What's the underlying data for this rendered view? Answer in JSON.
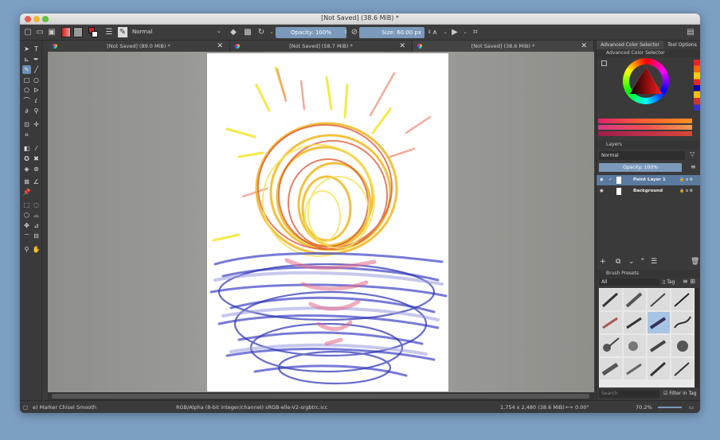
{
  "window": {
    "title": "[Not Saved]  (38.6 MiB) *"
  },
  "toolbar": {
    "blend_mode": "Normal",
    "opacity_label": "Opacity: 100%",
    "size_label": "Size: 60.00 px"
  },
  "tabs": [
    {
      "label": "[Not Saved]  (89.0 MiB) *",
      "close": "✕"
    },
    {
      "label": "[Not Saved]  (58.7 MiB) *",
      "close": "✕"
    },
    {
      "label": "[Not Saved]  (38.6 MiB) *",
      "close": "✕"
    }
  ],
  "dock": {
    "tab_color_selector": "Advanced Color Selector",
    "tab_tool_options": "Tool Options",
    "color_selector_title": "Advanced Color Selector",
    "layers_title": "Layers",
    "layers_blend": "Normal",
    "layers_opacity": "Opacity:  100%",
    "layers": [
      {
        "name": "Paint Layer 1",
        "selected": true
      },
      {
        "name": "Background",
        "selected": false
      }
    ],
    "brush_presets_title": "Brush Presets",
    "brush_filter": "All",
    "brush_tag": "Tag",
    "search_placeholder": "Search",
    "filter_in_tag": "Filter in Tag"
  },
  "status": {
    "brush": "e) Marker Chisel Smooth",
    "color_space": "RGB/Alpha (8-bit integer/channel)  sRGB-elle-V2-srgbtrc.icc",
    "image_size": "1,754 x 2,480 (38.6 MiB)",
    "rotation": "0.00°",
    "zoom": "70.2%"
  },
  "colors": {
    "accent": "#6c8fb8",
    "bg": "#3a3a3a",
    "desktop": "#7d9fc4"
  }
}
